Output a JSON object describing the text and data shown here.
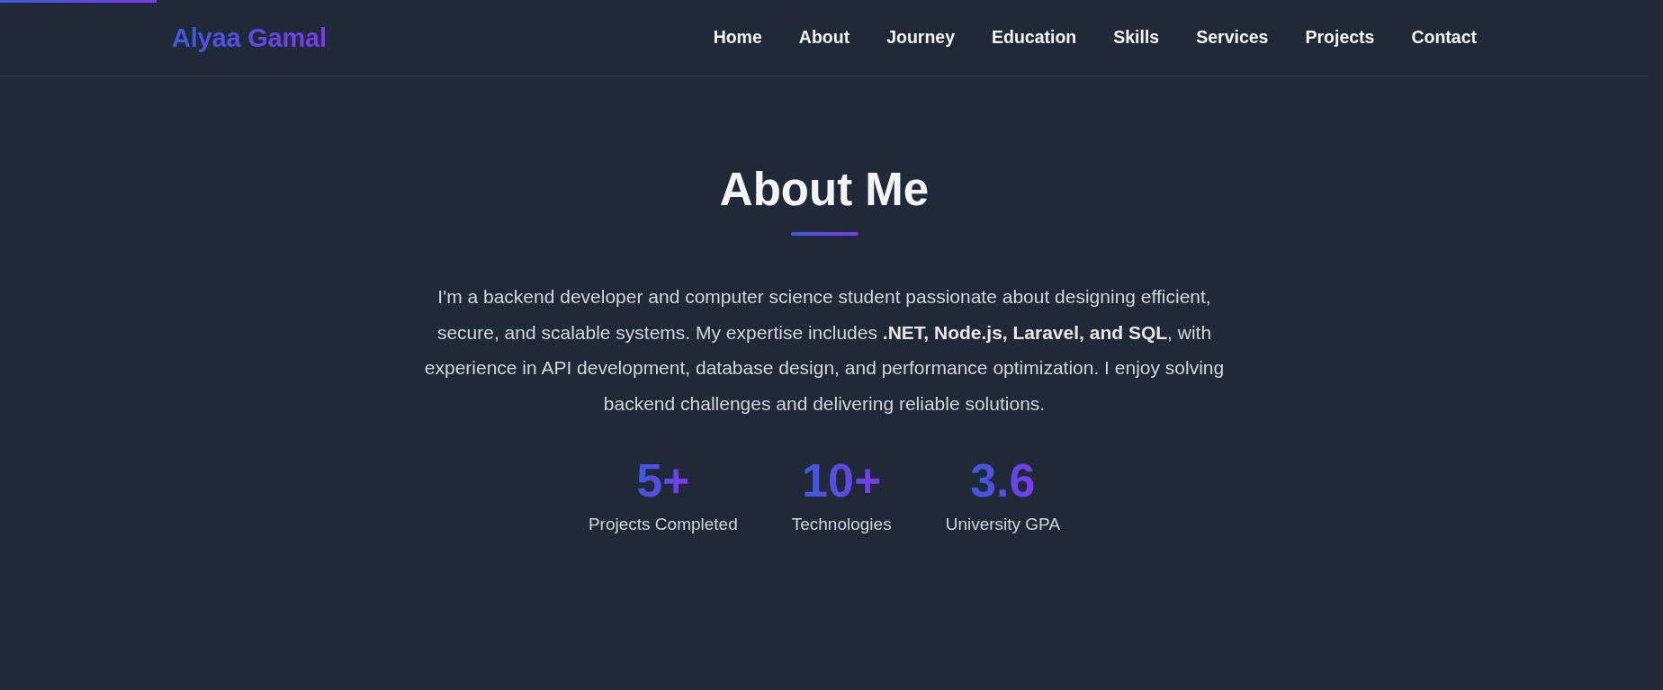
{
  "scroll_progress": {
    "level": 0.094
  },
  "navbar": {
    "logo": "Alyaa Gamal",
    "links": [
      {
        "label": "Home"
      },
      {
        "label": "About"
      },
      {
        "label": "Journey"
      },
      {
        "label": "Education"
      },
      {
        "label": "Skills"
      },
      {
        "label": "Services"
      },
      {
        "label": "Projects"
      },
      {
        "label": "Contact"
      }
    ]
  },
  "about": {
    "heading": "About Me",
    "paragraph": "I'm a backend developer and computer science student passionate about designing efficient, secure, and scalable systems. My expertise includes **.NET, Node.js, Laravel, and SQL**, with experience in API development, database design, and performance optimization. I enjoy solving backend challenges and delivering reliable solutions.",
    "stats": [
      {
        "value": "5+",
        "label": "Projects Completed"
      },
      {
        "value": "10+",
        "label": "Technologies"
      },
      {
        "value": "3.6",
        "label": "University GPA"
      }
    ]
  }
}
